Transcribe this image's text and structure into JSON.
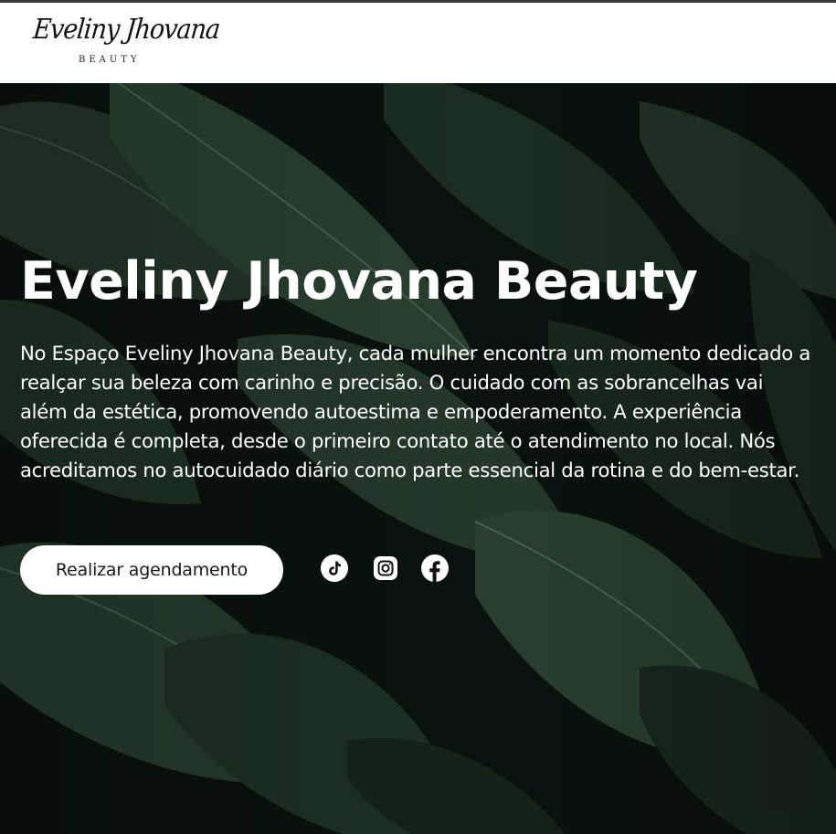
{
  "header": {
    "logo_script": "Eveliny Jhovana",
    "logo_sub": "BEAUTY"
  },
  "hero": {
    "title": "Eveliny Jhovana Beauty",
    "description": "No Espaço Eveliny Jhovana Beauty, cada mulher encontra um momento dedicado a realçar sua beleza com carinho e precisão. O cuidado com as sobrancelhas vai além da estética, promovendo autoestima e empoderamento. A experiência oferecida é completa, desde o primeiro contato até o atendimento no local. Nós acreditamos no autocuidado diário como parte essencial da rotina e do bem-estar.",
    "cta_label": "Realizar agendamento",
    "background": "dark-green-leaves-photo"
  },
  "social": [
    {
      "icon": "tiktok-icon"
    },
    {
      "icon": "instagram-icon"
    },
    {
      "icon": "facebook-icon"
    }
  ],
  "colors": {
    "header_bg": "#ffffff",
    "hero_text": "#ffffff",
    "cta_bg": "#ffffff",
    "cta_text": "#1a1a1a"
  }
}
